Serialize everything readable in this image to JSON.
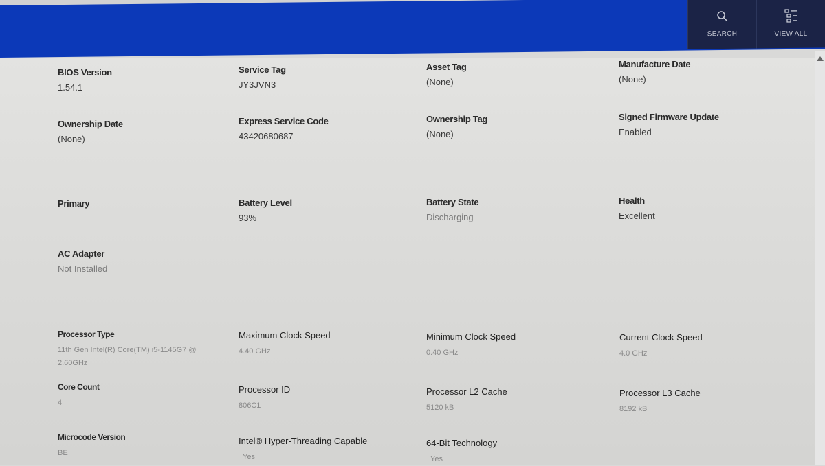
{
  "header": {
    "search_label": "SEARCH",
    "viewall_label": "VIEW ALL",
    "search_icon": "search-icon",
    "viewall_icon": "list-icon",
    "accent_color": "#0c39b8"
  },
  "system": {
    "bios_version": {
      "label": "BIOS Version",
      "value": "1.54.1"
    },
    "service_tag": {
      "label": "Service Tag",
      "value": "JY3JVN3"
    },
    "asset_tag": {
      "label": "Asset Tag",
      "value": "(None)"
    },
    "manufacture_date": {
      "label": "Manufacture Date",
      "value": "(None)"
    },
    "ownership_date": {
      "label": "Ownership Date",
      "value": "(None)"
    },
    "express_service_code": {
      "label": "Express Service Code",
      "value": "43420680687"
    },
    "ownership_tag": {
      "label": "Ownership Tag",
      "value": "(None)"
    },
    "signed_firmware_update": {
      "label": "Signed Firmware Update",
      "value": "Enabled"
    }
  },
  "battery": {
    "primary": {
      "label": "Primary"
    },
    "battery_level": {
      "label": "Battery Level",
      "value": "93%"
    },
    "battery_state": {
      "label": "Battery State",
      "value": "Discharging"
    },
    "health": {
      "label": "Health",
      "value": "Excellent"
    },
    "ac_adapter": {
      "label": "AC Adapter",
      "value": "Not Installed"
    }
  },
  "processor": {
    "processor_type": {
      "label": "Processor Type",
      "value": "11th Gen Intel(R) Core(TM) i5-1145G7 @ 2.60GHz"
    },
    "max_clock": {
      "label": "Maximum Clock Speed",
      "value": "4.40 GHz"
    },
    "min_clock": {
      "label": "Minimum Clock Speed",
      "value": "0.40 GHz"
    },
    "current_clock": {
      "label": "Current Clock Speed",
      "value": "4.0 GHz"
    },
    "core_count": {
      "label": "Core Count",
      "value": "4"
    },
    "processor_id": {
      "label": "Processor ID",
      "value": "806C1"
    },
    "l2_cache": {
      "label": "Processor L2 Cache",
      "value": "5120 kB"
    },
    "l3_cache": {
      "label": "Processor L3 Cache",
      "value": "8192 kB"
    },
    "microcode": {
      "label": "Microcode Version",
      "value": "BE"
    },
    "hyperthreading": {
      "label": "Intel® Hyper-Threading Capable",
      "value": "Yes"
    },
    "bit64": {
      "label": "64-Bit Technology",
      "value": "Yes"
    }
  }
}
